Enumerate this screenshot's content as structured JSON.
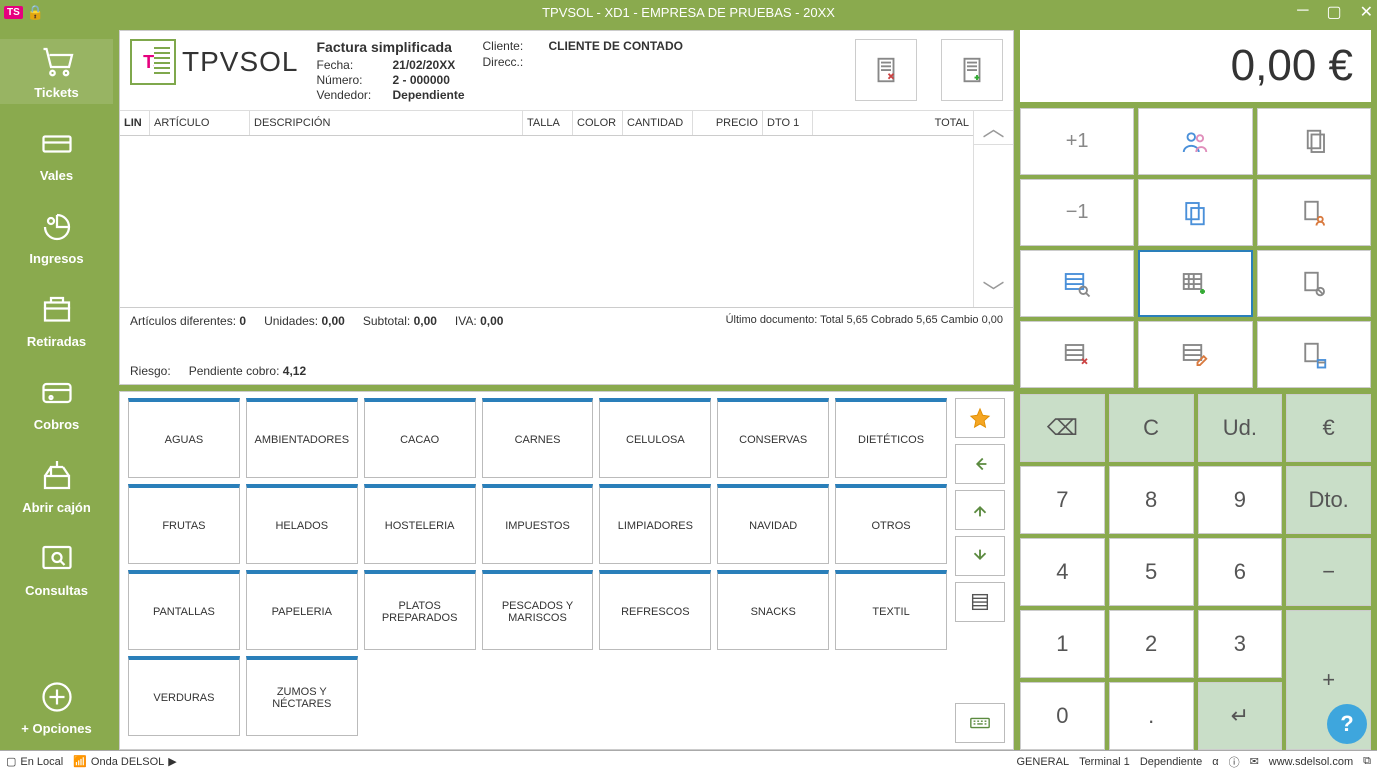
{
  "titlebar": {
    "title": "TPVSOL - XD1 - EMPRESA DE PRUEBAS - 20XX"
  },
  "sidebar": {
    "items": [
      {
        "label": "Tickets"
      },
      {
        "label": "Vales"
      },
      {
        "label": "Ingresos"
      },
      {
        "label": "Retiradas"
      },
      {
        "label": "Cobros"
      },
      {
        "label": "Abrir cajón"
      },
      {
        "label": "Consultas"
      }
    ],
    "options_label": "+ Opciones"
  },
  "ticket": {
    "logo_text": "TPVSOL",
    "meta": {
      "title": "Factura simplificada",
      "fecha_label": "Fecha:",
      "fecha": "21/02/20XX",
      "numero_label": "Número:",
      "numero": "2 - 000000",
      "vendedor_label": "Vendedor:",
      "vendedor": "Dependiente"
    },
    "client": {
      "cliente_label": "Cliente:",
      "cliente": "CLIENTE DE CONTADO",
      "direcc_label": "Direcc.:",
      "direcc": ""
    },
    "columns": [
      "LIN",
      "ARTÍCULO",
      "DESCRIPCIÓN",
      "TALLA",
      "COLOR",
      "CANTIDAD",
      "PRECIO",
      "DTO 1",
      "TOTAL"
    ],
    "summary": {
      "art_dif_label": "Artículos diferentes:",
      "art_dif": "0",
      "unidades_label": "Unidades:",
      "unidades": "0,00",
      "subtotal_label": "Subtotal:",
      "subtotal": "0,00",
      "iva_label": "IVA:",
      "iva": "0,00",
      "riesgo_label": "Riesgo:",
      "riesgo": "",
      "pendiente_label": "Pendiente cobro:",
      "pendiente": "4,12",
      "ultimo": "Último documento: Total 5,65 Cobrado 5,65 Cambio 0,00"
    }
  },
  "categories": [
    "AGUAS",
    "AMBIENTADORES",
    "CACAO",
    "CARNES",
    "CELULOSA",
    "CONSERVAS",
    "DIETÉTICOS",
    "FRUTAS",
    "HELADOS",
    "HOSTELERIA",
    "IMPUESTOS",
    "LIMPIADORES",
    "NAVIDAD",
    "OTROS",
    "PANTALLAS",
    "PAPELERIA",
    "PLATOS PREPARADOS",
    "PESCADOS Y MARISCOS",
    "REFRESCOS",
    "SNACKS",
    "TEXTIL",
    "VERDURAS",
    "ZUMOS Y NÉCTARES"
  ],
  "total": {
    "value": "0,00 €"
  },
  "actions": {
    "plus1": "+1",
    "minus1": "−1"
  },
  "keypad": {
    "back": "⌫",
    "c": "C",
    "ud": "Ud.",
    "euro": "€",
    "k7": "7",
    "k8": "8",
    "k9": "9",
    "dto": "Dto.",
    "k4": "4",
    "k5": "5",
    "k6": "6",
    "minus": "−",
    "k1": "1",
    "k2": "2",
    "k3": "3",
    "plus": "+",
    "k0": "0",
    "dot": ".",
    "enter": "↵"
  },
  "status": {
    "en_local": "En Local",
    "onda": "Onda DELSOL",
    "general": "GENERAL",
    "terminal": "Terminal 1",
    "user": "Dependiente",
    "url": "www.sdelsol.com"
  }
}
